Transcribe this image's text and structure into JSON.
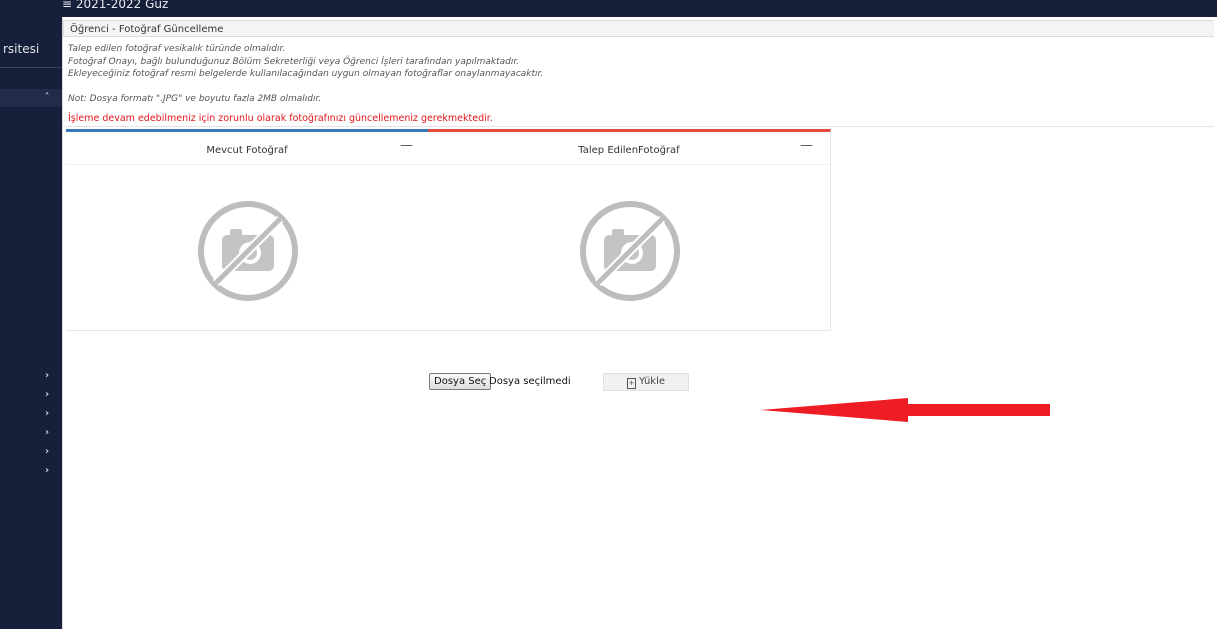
{
  "header": {
    "term": "≡ 2021-2022 Güz"
  },
  "sidebar": {
    "brand_fragment": "rsitesi",
    "collapse_glyph": "˄",
    "item_glyph": "›"
  },
  "panel": {
    "title": "Öğrenci - Fotoğraf Güncelleme",
    "notes": [
      "Talep edilen fotoğraf vesikalık türünde olmalıdır.",
      "Fotoğraf Onayı, bağlı bulunduğunuz Bölüm Sekreterliği veya Öğrenci İşleri tarafından yapılmaktadır.",
      "Ekleyeceğiniz fotoğraf resmi belgelerde kullanılacağından uygun olmayan fotoğraflar onaylanmayacaktır.",
      "Not: Dosya formatı \".JPG\" ve boyutu fazla 2MB olmalıdır."
    ],
    "warning": "İşleme devam edebilmeniz için zorunlu olarak fotoğrafınızı güncellemeniz gerekmektedir."
  },
  "cards": {
    "current": {
      "title": "Mevcut Fotoğraf",
      "collapse": "—",
      "icon": "no-photo-icon"
    },
    "requested": {
      "title": "Talep EdilenFotoğraf",
      "collapse": "—",
      "icon": "no-photo-icon"
    }
  },
  "upload": {
    "file_button": "Dosya Seç",
    "file_status": "Dosya seçilmedi",
    "upload_button": "Yükle"
  },
  "colors": {
    "accent_blue": "#3479b8",
    "accent_red": "#e04d3c",
    "warning_red": "#e0161b",
    "arrow_red": "#ee1c24",
    "nav_bg": "#17203a"
  }
}
